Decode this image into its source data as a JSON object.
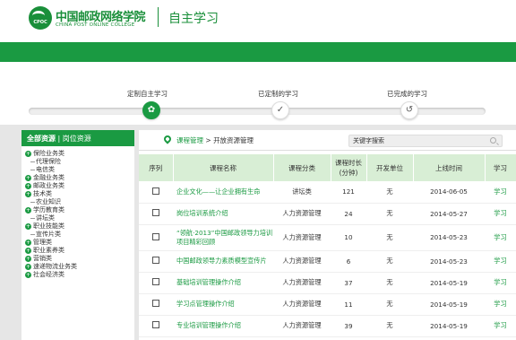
{
  "header": {
    "logo_cn": "中国邮政网络学院",
    "logo_en": "CHINA POST ONLINE COLLEGE",
    "logo_badge": "CPOC",
    "title": "自主学习"
  },
  "progress": {
    "steps": [
      {
        "label": "定制自主学习",
        "icon": "gear-icon",
        "glyph": "✿"
      },
      {
        "label": "已定制的学习",
        "icon": "check-icon",
        "glyph": "✓"
      },
      {
        "label": "已完成的学习",
        "icon": "history-icon",
        "glyph": "↺"
      }
    ]
  },
  "sidebar": {
    "tab_all": "全部资源",
    "tab_sep": "|",
    "tab_post": "岗位资源",
    "items": [
      {
        "label": "保险业务类",
        "level": 0,
        "toggle": "+"
      },
      {
        "label": "代理保险",
        "level": 1
      },
      {
        "label": "电信类",
        "level": 1
      },
      {
        "label": "金融业务类",
        "level": 0,
        "toggle": "+"
      },
      {
        "label": "邮政业务类",
        "level": 0,
        "toggle": "+"
      },
      {
        "label": "技术类",
        "level": 0,
        "toggle": "+"
      },
      {
        "label": "农业知识",
        "level": 1
      },
      {
        "label": "学历教育类",
        "level": 0,
        "toggle": "+"
      },
      {
        "label": "讲坛类",
        "level": 1
      },
      {
        "label": "职业技能类",
        "level": 0,
        "toggle": "+"
      },
      {
        "label": "宣传片类",
        "level": 1
      },
      {
        "label": "管理类",
        "level": 0,
        "toggle": "+"
      },
      {
        "label": "职业素养类",
        "level": 0,
        "toggle": "+"
      },
      {
        "label": "营销类",
        "level": 0,
        "toggle": "+"
      },
      {
        "label": "速递物流业务类",
        "level": 0,
        "toggle": "+"
      },
      {
        "label": "社会经济类",
        "level": 0,
        "toggle": "+"
      }
    ]
  },
  "breadcrumb": {
    "link": "课程管理",
    "sep": " > ",
    "current": "开放资源管理"
  },
  "search": {
    "placeholder": "关键字搜索"
  },
  "table": {
    "headers": [
      "序列",
      "课程名称",
      "课程分类",
      "课程时长(分钟)",
      "开发单位",
      "上线时间",
      "学习"
    ],
    "rows": [
      {
        "name": "企业文化——让企业拥有生命",
        "category": "讲坛类",
        "duration": "121",
        "unit": "无",
        "date": "2014-06-05",
        "action": "学习"
      },
      {
        "name": "岗位培训系统介绍",
        "category": "人力资源管理",
        "duration": "24",
        "unit": "无",
        "date": "2014-05-27",
        "action": "学习"
      },
      {
        "name": "“领航·2013”中国邮政领导力培训项目精彩回顾",
        "category": "人力资源管理",
        "duration": "10",
        "unit": "无",
        "date": "2014-05-23",
        "action": "学习"
      },
      {
        "name": "中国邮政领导力素质模型宣传片",
        "category": "人力资源管理",
        "duration": "6",
        "unit": "无",
        "date": "2014-05-23",
        "action": "学习"
      },
      {
        "name": "基础培训管理操作介绍",
        "category": "人力资源管理",
        "duration": "37",
        "unit": "无",
        "date": "2014-05-19",
        "action": "学习"
      },
      {
        "name": "学习点管理操作介绍",
        "category": "人力资源管理",
        "duration": "11",
        "unit": "无",
        "date": "2014-05-19",
        "action": "学习"
      },
      {
        "name": "专业培训管理操作介绍",
        "category": "人力资源管理",
        "duration": "39",
        "unit": "无",
        "date": "2014-05-19",
        "action": "学习"
      }
    ]
  }
}
